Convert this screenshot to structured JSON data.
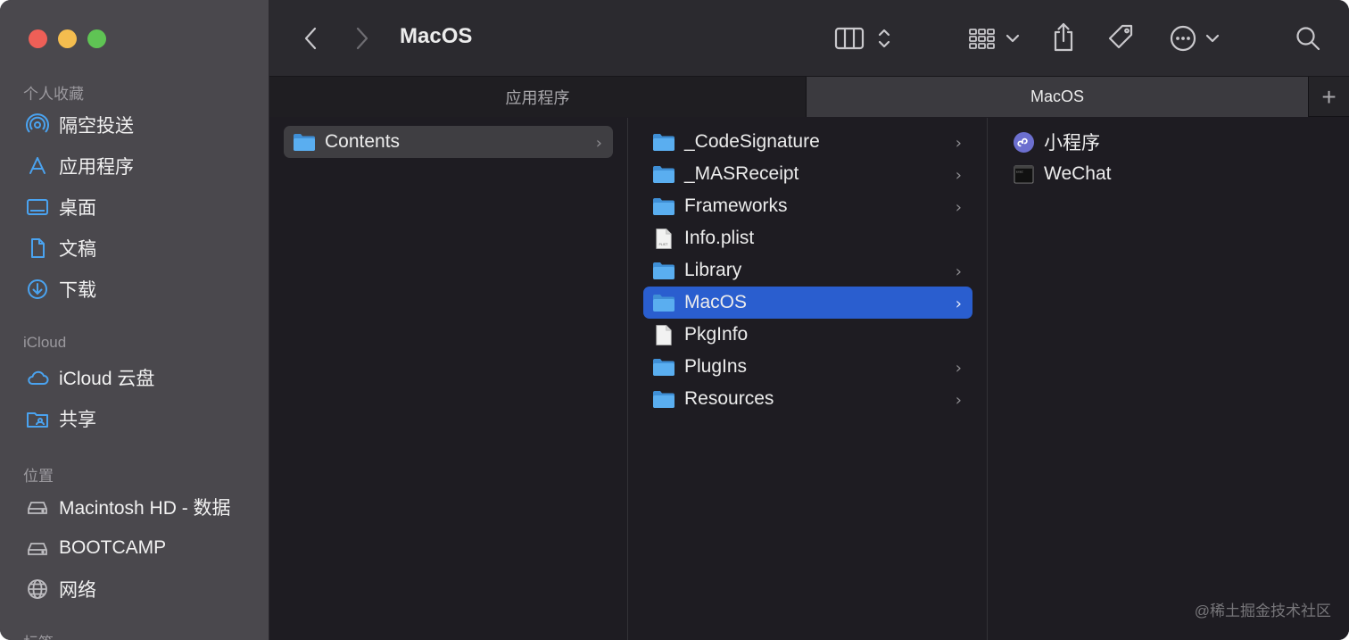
{
  "window": {
    "title": "MacOS"
  },
  "sidebar": {
    "sections": [
      {
        "title": "个人收藏",
        "items": [
          {
            "label": "隔空投送",
            "icon": "airdrop-icon"
          },
          {
            "label": "应用程序",
            "icon": "applications-icon"
          },
          {
            "label": "桌面",
            "icon": "desktop-icon"
          },
          {
            "label": "文稿",
            "icon": "document-icon"
          },
          {
            "label": "下载",
            "icon": "download-icon"
          }
        ]
      },
      {
        "title": "iCloud",
        "items": [
          {
            "label": "iCloud 云盘",
            "icon": "cloud-icon"
          },
          {
            "label": "共享",
            "icon": "shared-folder-icon"
          }
        ]
      },
      {
        "title": "位置",
        "items": [
          {
            "label": "Macintosh HD - 数据",
            "icon": "hard-drive-icon"
          },
          {
            "label": "BOOTCAMP",
            "icon": "hard-drive-icon"
          },
          {
            "label": "网络",
            "icon": "network-globe-icon"
          }
        ]
      },
      {
        "title": "标签",
        "items": []
      }
    ]
  },
  "tabs": [
    {
      "label": "应用程序",
      "active": false
    },
    {
      "label": "MacOS",
      "active": true
    }
  ],
  "tab_add_label": "+",
  "columns": [
    {
      "items": [
        {
          "label": "Contents",
          "type": "folder",
          "has_children": true,
          "selected": "inactive"
        }
      ]
    },
    {
      "items": [
        {
          "label": "_CodeSignature",
          "type": "folder",
          "has_children": true
        },
        {
          "label": "_MASReceipt",
          "type": "folder",
          "has_children": true
        },
        {
          "label": "Frameworks",
          "type": "folder",
          "has_children": true
        },
        {
          "label": "Info.plist",
          "type": "plist",
          "has_children": false
        },
        {
          "label": "Library",
          "type": "folder",
          "has_children": true
        },
        {
          "label": "MacOS",
          "type": "folder",
          "has_children": true,
          "selected": "active"
        },
        {
          "label": "PkgInfo",
          "type": "file",
          "has_children": false
        },
        {
          "label": "PlugIns",
          "type": "folder",
          "has_children": true
        },
        {
          "label": "Resources",
          "type": "folder",
          "has_children": true
        }
      ]
    },
    {
      "items": [
        {
          "label": "小程序",
          "type": "miniprogram",
          "has_children": false
        },
        {
          "label": "WeChat",
          "type": "executable",
          "has_children": false
        }
      ]
    }
  ],
  "chevron": "›",
  "watermark": "@稀土掘金技术社区",
  "colors": {
    "accent": "#2a5ecf",
    "folder": "#5aaef0",
    "sidebar_icon": "#4aa3f0"
  }
}
